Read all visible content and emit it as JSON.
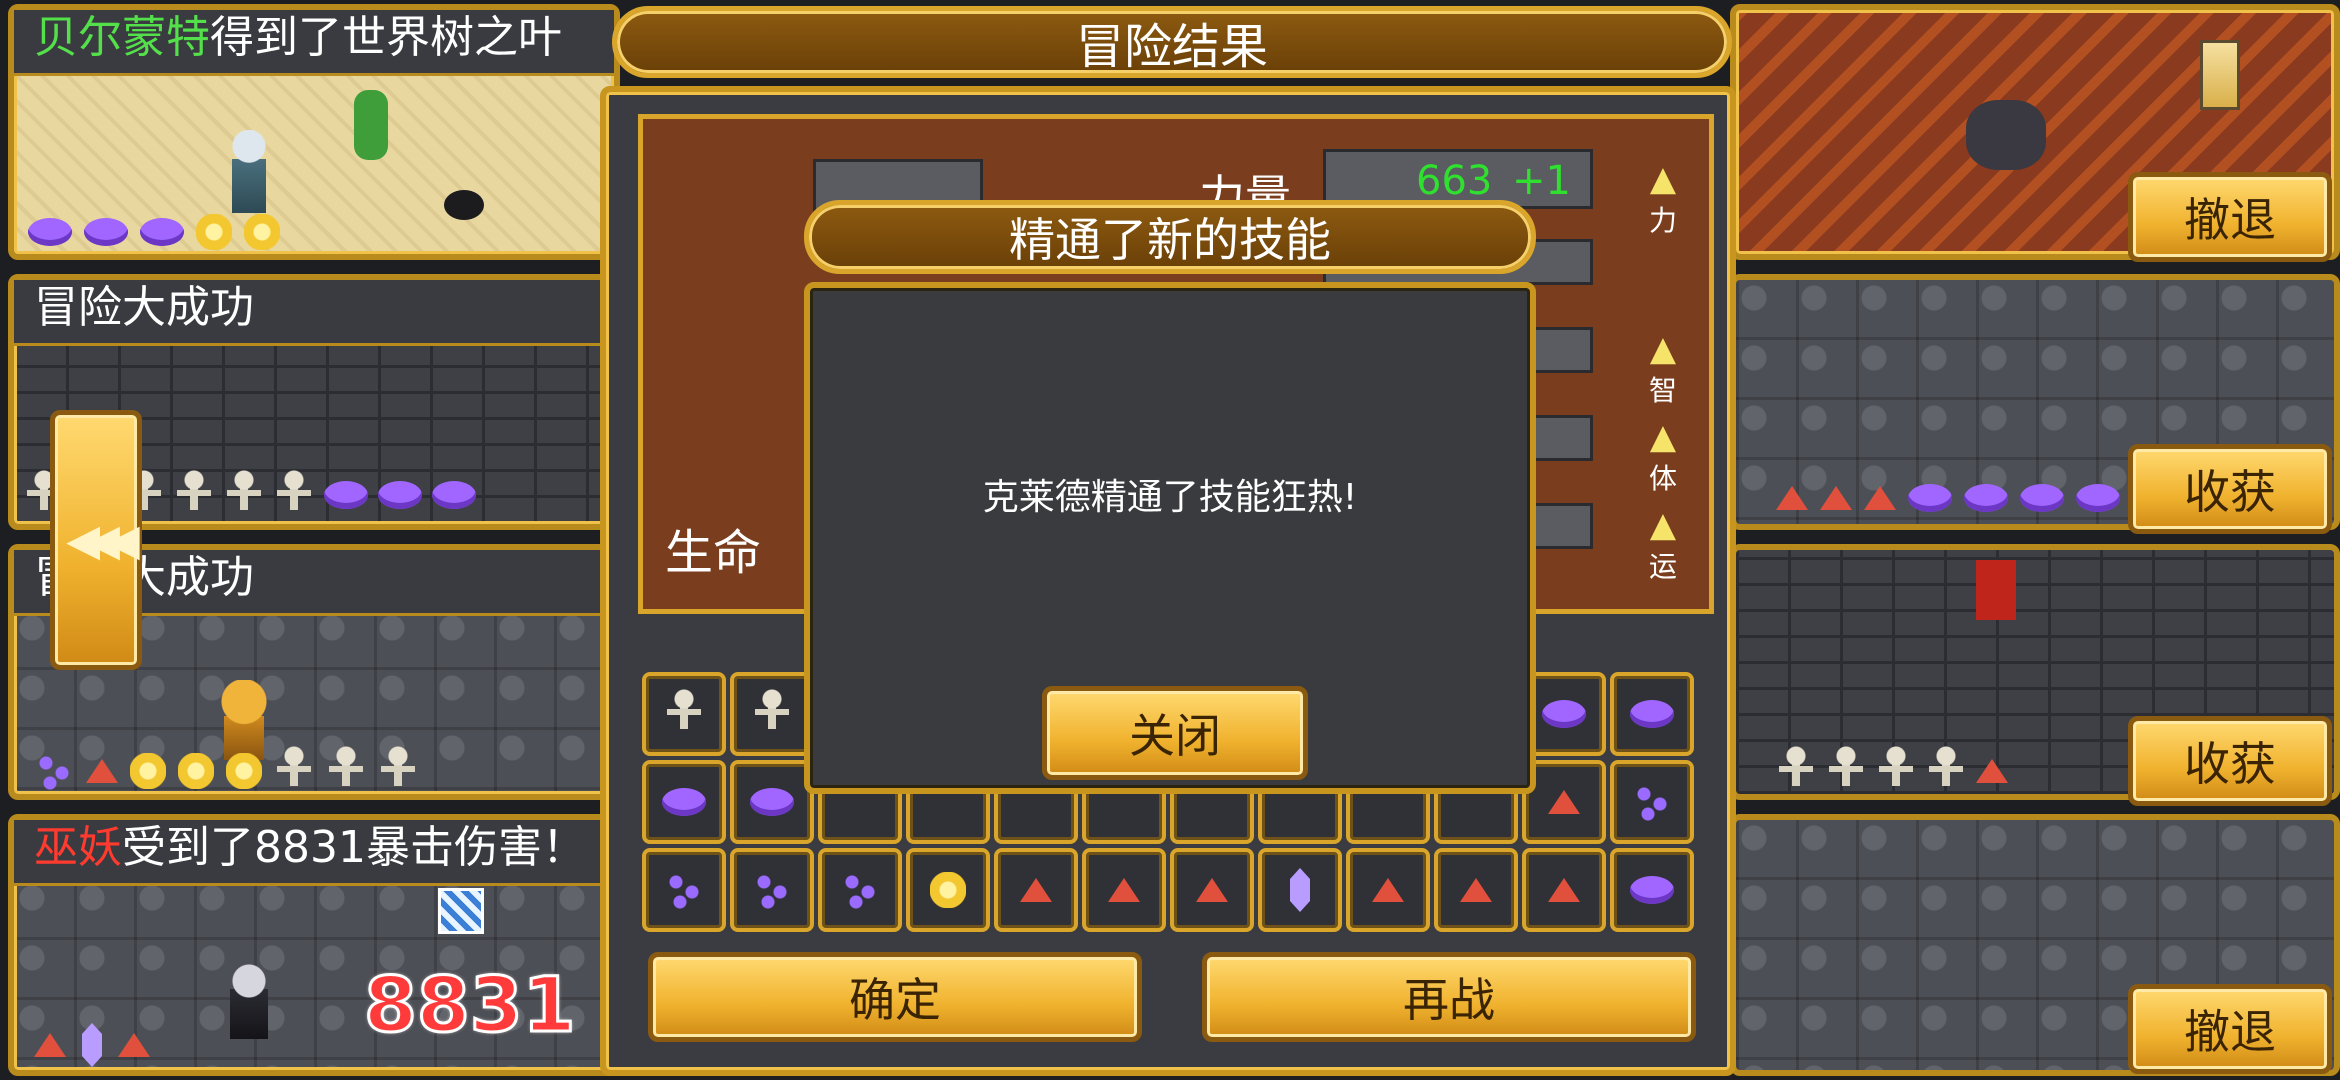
{
  "lanes": {
    "lane1": {
      "banner_name": "贝尔蒙特",
      "banner_text": "得到了世界树之叶",
      "button": "撤退"
    },
    "lane2": {
      "banner": "冒险大成功",
      "button": "收获"
    },
    "lane3": {
      "banner": "冒险大成功",
      "button": "收获"
    },
    "lane4": {
      "banner_name": "巫妖",
      "banner_text": "受到了8831暴击伤害！",
      "damage": "8831",
      "button": "撤退"
    }
  },
  "result_panel": {
    "title": "冒险结果",
    "stats": {
      "strength_label": "力量",
      "strength_value": "663",
      "strength_bonus": "+1",
      "life_label": "生命",
      "icons": [
        "力",
        "智",
        "体",
        "运"
      ]
    },
    "confirm_button": "确定",
    "rematch_button": "再战"
  },
  "skill_popup": {
    "title": "精通了新的技能",
    "message": "克莱德精通了技能狂热!",
    "close_button": "关闭"
  },
  "colors": {
    "gold": "#f0b22e",
    "name_green": "#54e04a",
    "name_red": "#ff3b2f",
    "stat_green": "#2fe02f"
  },
  "icons": {
    "back_button": "triple-chevron-left-icon"
  }
}
